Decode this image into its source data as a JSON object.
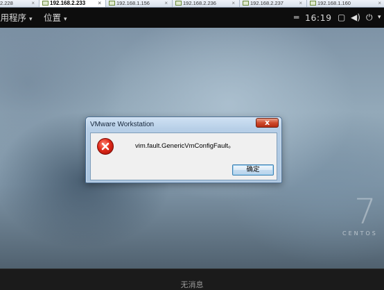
{
  "host_tabs": [
    {
      "label": "2.228",
      "active": false
    },
    {
      "label": "192.168.2.233",
      "active": true
    },
    {
      "label": "192.168.1.156",
      "active": false
    },
    {
      "label": "192.168.2.236",
      "active": false
    },
    {
      "label": "192.168.2.237",
      "active": false
    },
    {
      "label": "192.168.1.160",
      "active": false
    }
  ],
  "topbar": {
    "applications": "应用程序",
    "places": "位置",
    "clock": "16:19",
    "icons": [
      "window-icon",
      "volume-icon",
      "power-icon",
      "chevron-down-icon",
      "input-method-icon"
    ]
  },
  "desktop": {
    "brand_number": "7",
    "brand_word": "CENTOS"
  },
  "tray": {
    "message": "无消息"
  },
  "dialog": {
    "title": "VMware Workstation",
    "close_glyph": "x",
    "message": "vim.fault.GenericVmConfigFault。",
    "ok_label": "确定",
    "icon": "error-icon"
  },
  "colors": {
    "dialog_frame": "#a9c4df",
    "close_button": "#cf4a2c",
    "topbar_bg": "#0d0d0d",
    "tray_bg": "#1b1b1b"
  }
}
